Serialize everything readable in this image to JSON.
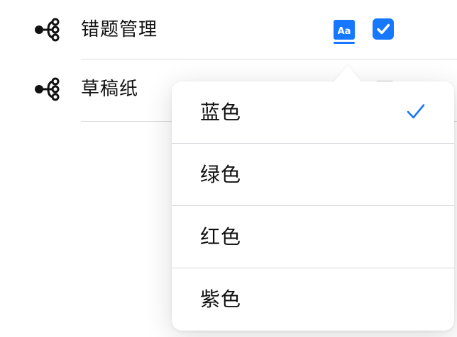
{
  "list": {
    "items": [
      {
        "label": "错题管理",
        "icon": "share-node-icon",
        "checked": true,
        "has_dictionary_icon": true
      },
      {
        "label": "草稿纸",
        "icon": "share-node-icon",
        "checked": false
      }
    ]
  },
  "popover": {
    "options": [
      {
        "label": "蓝色",
        "selected": true
      },
      {
        "label": "绿色",
        "selected": false
      },
      {
        "label": "红色",
        "selected": false
      },
      {
        "label": "紫色",
        "selected": false
      }
    ]
  },
  "colors": {
    "accent": "#1677ff",
    "text": "#111111",
    "divider": "#d8d8dc",
    "background": "#ffffff"
  }
}
